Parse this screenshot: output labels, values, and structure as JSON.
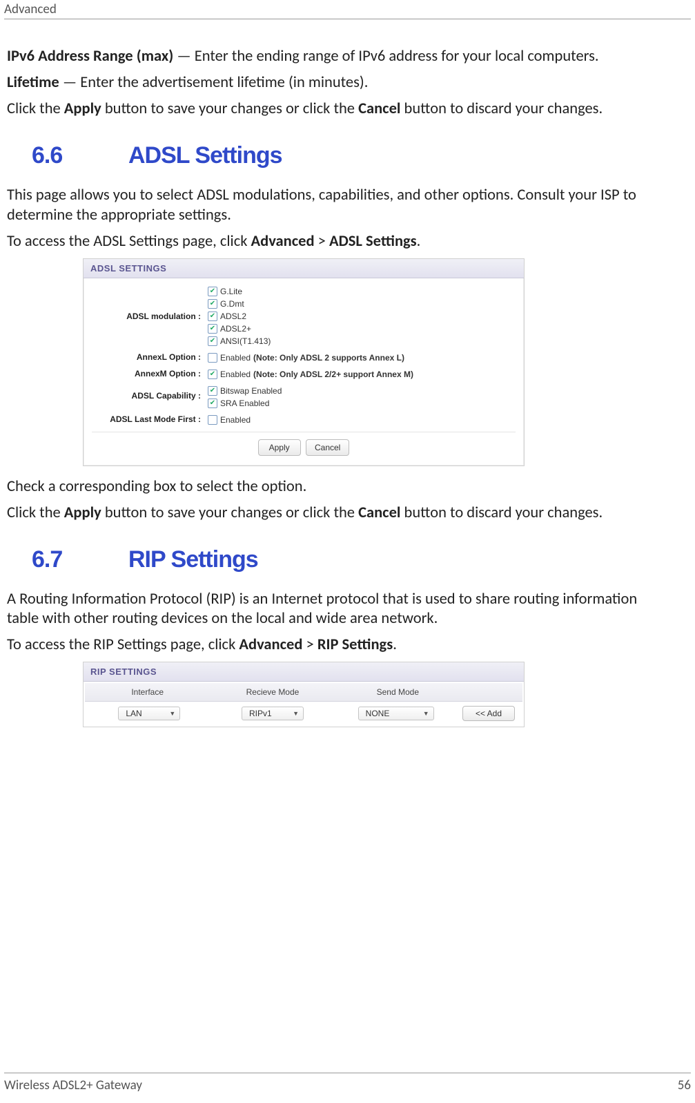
{
  "header": {
    "title": "Advanced"
  },
  "intro": {
    "p1_bold": "IPv6 Address Range (max)",
    "p1_rest": " — Enter the ending range of IPv6 address for your local computers.",
    "p2_bold": "Lifetime",
    "p2_rest": " — Enter the advertisement lifetime (in minutes).",
    "p3_a": "Click the ",
    "p3_apply": "Apply",
    "p3_b": " button to save your changes or click the ",
    "p3_cancel": "Cancel",
    "p3_c": " button to discard your changes."
  },
  "sec66": {
    "num": "6.6",
    "title": "ADSL Settings",
    "p1": "This page allows you to select ADSL modulations, capabilities, and other options. Consult your ISP to determine the appropriate settings.",
    "p2_a": "To access the ADSL Settings page, click ",
    "p2_adv": "Advanced",
    "p2_gt": " > ",
    "p2_link": "ADSL Settings",
    "p2_end": "."
  },
  "adsl_panel": {
    "title": "ADSL SETTINGS",
    "labels": {
      "modulation": "ADSL modulation  :",
      "annexl": "AnnexL Option  :",
      "annexm": "AnnexM Option  :",
      "capability": "ADSL Capability  :",
      "lastmode": "ADSL Last Mode First  :"
    },
    "mods": [
      "G.Lite",
      "G.Dmt",
      "ADSL2",
      "ADSL2+",
      "ANSI(T1.413)"
    ],
    "annexl_text": "Enabled ",
    "annexl_note": "(Note: Only ADSL 2 supports Annex L)",
    "annexm_text": "Enabled ",
    "annexm_note": "(Note: Only ADSL 2/2+ support Annex M)",
    "cap1": "Bitswap Enabled",
    "cap2": "SRA Enabled",
    "lastmode_text": "Enabled",
    "apply": "Apply",
    "cancel": "Cancel"
  },
  "post_adsl": {
    "p1": "Check a corresponding box to select the option.",
    "p2_a": "Click the ",
    "p2_apply": "Apply",
    "p2_b": " button to save your changes or click the ",
    "p2_cancel": "Cancel",
    "p2_c": " button to discard your changes."
  },
  "sec67": {
    "num": "6.7",
    "title": "RIP Settings",
    "p1": "A Routing Information Protocol (RIP) is an Internet protocol that is used to share routing information table with other routing devices on the local and wide area network.",
    "p2_a": "To access the RIP Settings page, click ",
    "p2_adv": "Advanced",
    "p2_gt": " > ",
    "p2_link": "RIP Settings",
    "p2_end": "."
  },
  "rip_panel": {
    "title": "RIP SETTINGS",
    "headers": [
      "Interface",
      "Recieve Mode",
      "Send Mode",
      ""
    ],
    "row": {
      "iface": "LAN",
      "recv": "RIPv1",
      "send": "NONE",
      "add": "<< Add"
    }
  },
  "footer": {
    "left": "Wireless ADSL2+ Gateway",
    "right": "56"
  }
}
